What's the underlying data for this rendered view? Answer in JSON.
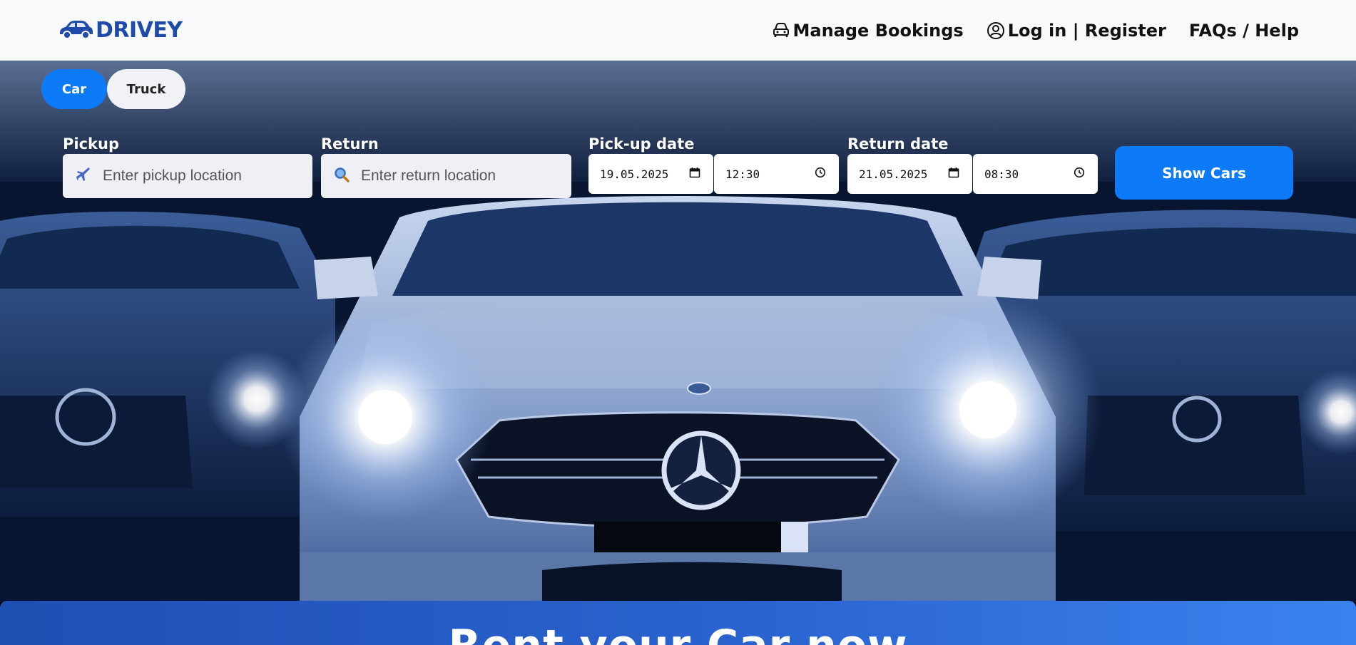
{
  "header": {
    "brand": "DRIVEY",
    "logo_icon": "car-icon",
    "nav": [
      {
        "label": "Manage Bookings",
        "icon": "car-front-icon"
      },
      {
        "label": "Log in | Register",
        "icon": "user-circle-icon"
      },
      {
        "label": "FAQs / Help",
        "icon": ""
      }
    ]
  },
  "tabs": [
    {
      "label": "Car",
      "active": true
    },
    {
      "label": "Truck",
      "active": false
    }
  ],
  "search": {
    "pickup_label": "Pickup",
    "pickup_placeholder": "Enter pickup location",
    "pickup_icon": "airplane-icon",
    "return_label": "Return",
    "return_placeholder": "Enter return location",
    "return_icon": "magnifier-icon",
    "pickup_date_label": "Pick-up date",
    "pickup_date": "19.05.2025",
    "pickup_time": "12:30",
    "return_date_label": "Return date",
    "return_date": "21.05.2025",
    "return_time": "08:30",
    "submit_label": "Show Cars"
  },
  "banner": {
    "title": "Rent your Car now"
  },
  "colors": {
    "brand": "#1f4aa8",
    "primary": "#0d7bf7",
    "header_bg": "#f8f9fb"
  }
}
